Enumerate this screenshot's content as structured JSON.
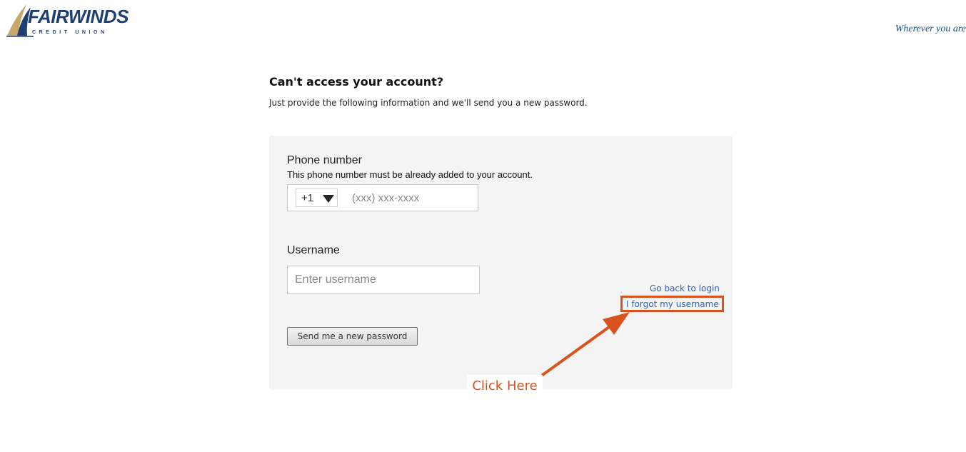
{
  "brand": {
    "name": "FAIRWINDS",
    "sub": "CREDIT UNION",
    "tagline": "Wherever you are"
  },
  "page": {
    "title": "Can't access your account?",
    "subtitle": "Just provide the following information and we'll send you a new password."
  },
  "form": {
    "phone": {
      "label": "Phone number",
      "help": "This phone number must be already added to your account.",
      "country_code": "+1",
      "placeholder": "(xxx) xxx-xxxx"
    },
    "username": {
      "label": "Username",
      "placeholder": "Enter username"
    },
    "submit_label": "Send me a new password"
  },
  "links": {
    "back_to_login": "Go back to login",
    "forgot_username": "I forgot my username"
  },
  "annotation": {
    "callout": "Click Here",
    "color": "#d9531e"
  },
  "colors": {
    "brand_navy": "#1f3f73",
    "link_blue": "#2a64c2",
    "panel_bg": "#f4f4f4"
  }
}
